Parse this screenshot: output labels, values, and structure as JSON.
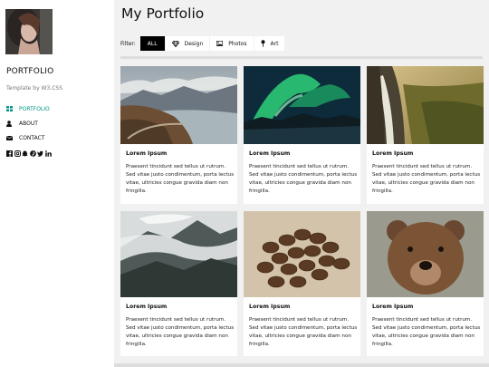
{
  "sidebar": {
    "brand": "PORTFOLIO",
    "tagline": "Template by W3.CSS",
    "nav": [
      {
        "label": "PORTFOLIO",
        "icon": "grid-icon",
        "active": true
      },
      {
        "label": "ABOUT",
        "icon": "user-icon",
        "active": false
      },
      {
        "label": "CONTACT",
        "icon": "envelope-icon",
        "active": false
      }
    ],
    "social": [
      "facebook-icon",
      "instagram-icon",
      "snapchat-icon",
      "pinterest-icon",
      "twitter-icon",
      "linkedin-icon"
    ]
  },
  "main": {
    "title": "My Portfolio",
    "filter_label": "Filter:",
    "filters": [
      {
        "label": "ALL",
        "icon": "",
        "active": true
      },
      {
        "label": "Design",
        "icon": "diamond-icon",
        "active": false
      },
      {
        "label": "Photos",
        "icon": "photo-icon",
        "active": false
      },
      {
        "label": "Art",
        "icon": "map-pin-icon",
        "active": false
      }
    ],
    "cards": [
      {
        "title": "Lorem Ipsum",
        "text": "Praesent tincidunt sed tellus ut rutrum. Sed vitae justo condimentum, porta lectus vitae, ultricies congue gravida diam non fringilla.",
        "image": "mountain lake road"
      },
      {
        "title": "Lorem Ipsum",
        "text": "Praesent tincidunt sed tellus ut rutrum. Sed vitae justo condimentum, porta lectus vitae, ultricies congue gravida diam non fringilla.",
        "image": "northern lights"
      },
      {
        "title": "Lorem Ipsum",
        "text": "Praesent tincidunt sed tellus ut rutrum. Sed vitae justo condimentum, porta lectus vitae, ultricies congue gravida diam non fringilla.",
        "image": "waterfall cliff"
      },
      {
        "title": "Lorem Ipsum",
        "text": "Praesent tincidunt sed tellus ut rutrum. Sed vitae justo condimentum, porta lectus vitae, ultricies congue gravida diam non fringilla.",
        "image": "misty mountain"
      },
      {
        "title": "Lorem Ipsum",
        "text": "Praesent tincidunt sed tellus ut rutrum. Sed vitae justo condimentum, porta lectus vitae, ultricies congue gravida diam non fringilla.",
        "image": "coffee beans"
      },
      {
        "title": "Lorem Ipsum",
        "text": "Praesent tincidunt sed tellus ut rutrum. Sed vitae justo condimentum, porta lectus vitae, ultricies congue gravida diam non fringilla.",
        "image": "brown bear"
      }
    ]
  },
  "colors": {
    "accent": "#009688",
    "active_filter_bg": "#000000",
    "page_bg": "#f1f1f1"
  }
}
